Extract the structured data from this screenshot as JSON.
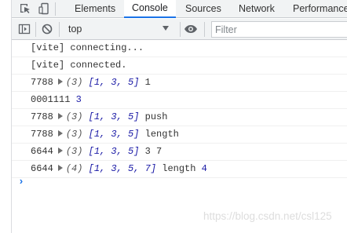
{
  "tabs": [
    {
      "label": "Elements"
    },
    {
      "label": "Console"
    },
    {
      "label": "Sources"
    },
    {
      "label": "Network"
    },
    {
      "label": "Performance"
    }
  ],
  "toolbar": {
    "context": "top",
    "filter_placeholder": "Filter"
  },
  "console": {
    "rows": [
      {
        "text": "[vite] connecting..."
      },
      {
        "text": "[vite] connected."
      },
      {
        "prefix": "7788",
        "length": "(3)",
        "array": "[1, 3, 5]",
        "suffix": "1"
      },
      {
        "prefix": "0001111",
        "value": "3"
      },
      {
        "prefix": "7788",
        "length": "(3)",
        "array": "[1, 3, 5]",
        "suffix": "push"
      },
      {
        "prefix": "7788",
        "length": "(3)",
        "array": "[1, 3, 5]",
        "suffix": "length"
      },
      {
        "prefix": "6644",
        "length": "(3)",
        "array": "[1, 3, 5]",
        "suffix": "3 7"
      },
      {
        "prefix": "6644",
        "length": "(4)",
        "array": "[1, 3, 5, 7]",
        "suffix": "length",
        "value": "4"
      }
    ],
    "prompt_symbol": "›"
  },
  "watermark": "https://blog.csdn.net/csl125",
  "colors": {
    "active_tab_underline": "#1a73e8",
    "number_blue": "#1a1aa6",
    "toolbar_bg": "#f1f3f4"
  }
}
